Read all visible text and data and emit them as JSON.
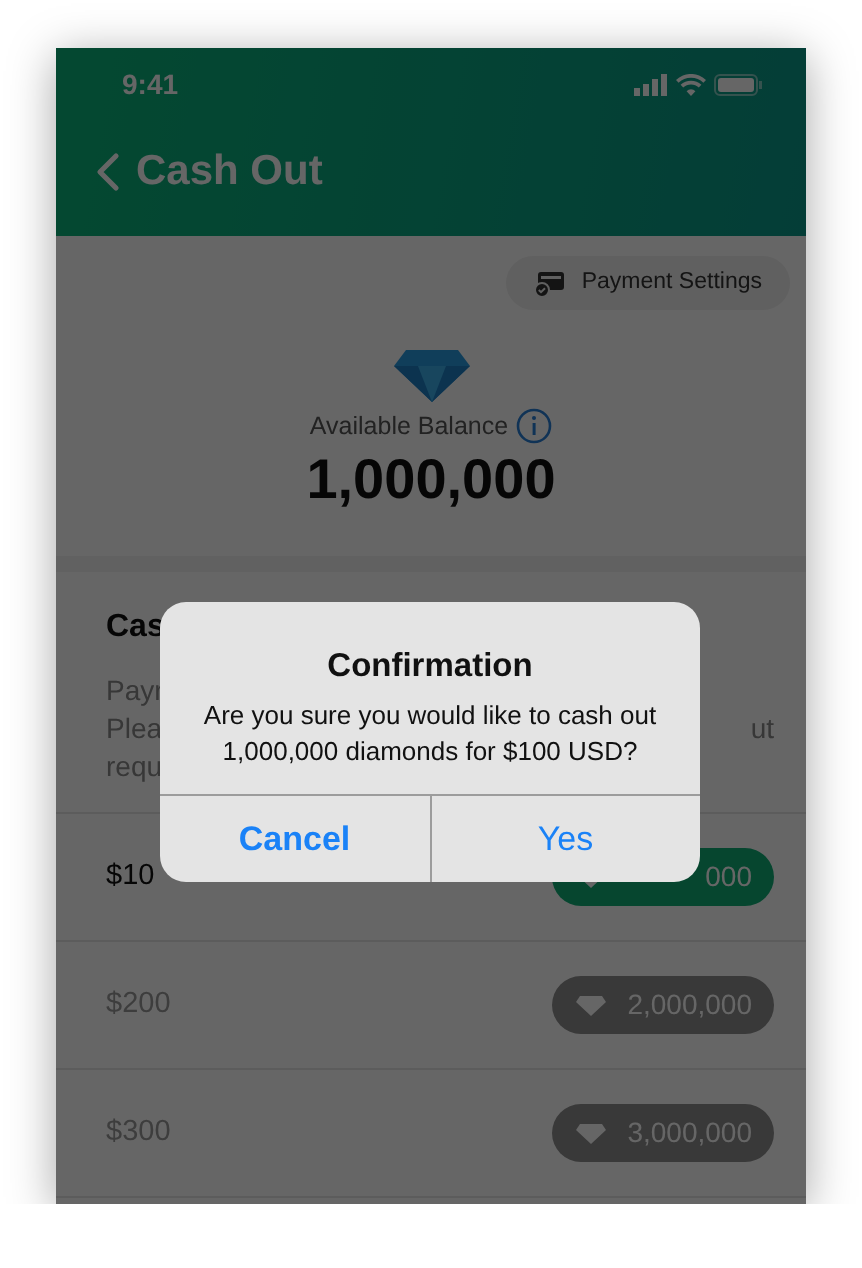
{
  "status_bar": {
    "time": "9:41"
  },
  "nav": {
    "title": "Cash Out"
  },
  "payment_settings": {
    "label": "Payment Settings"
  },
  "balance": {
    "label": "Available Balance",
    "amount": "1,000,000"
  },
  "section": {
    "title": "Cas",
    "description_lines": [
      {
        "left": "Payr"
      },
      {
        "left": "Plea",
        "right": "ut"
      },
      {
        "left": "requ"
      }
    ]
  },
  "options": [
    {
      "price": "$10",
      "diamonds": "000",
      "enabled": true
    },
    {
      "price": "$200",
      "diamonds": "2,000,000",
      "enabled": false
    },
    {
      "price": "$300",
      "diamonds": "3,000,000",
      "enabled": false
    }
  ],
  "dialog": {
    "title": "Confirmation",
    "message_lines": [
      "Are you sure you would like to cash out",
      "1,000,000 diamonds for $100 USD?"
    ],
    "buttons": [
      {
        "label": "Cancel",
        "kind": "cancel"
      },
      {
        "label": "Yes",
        "kind": "default"
      }
    ]
  }
}
